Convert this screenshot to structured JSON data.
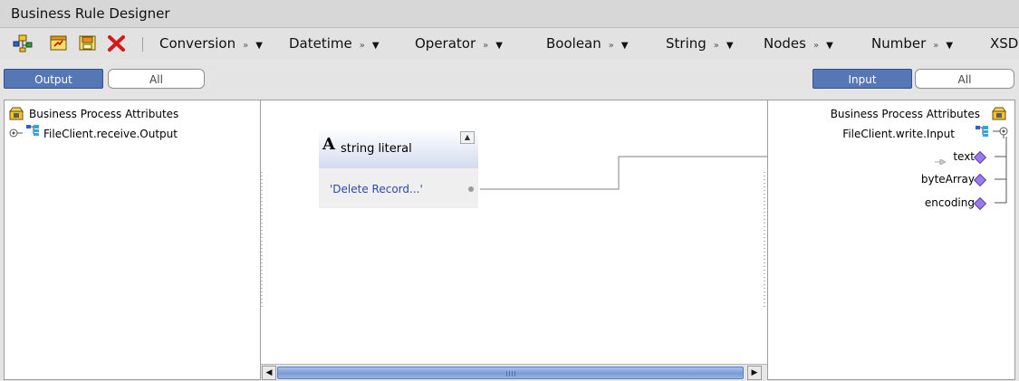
{
  "window": {
    "title": "Business Rule Designer"
  },
  "toolbar": {
    "icons": [
      "tree-add-icon",
      "edit-icon",
      "save-icon",
      "delete-icon"
    ],
    "menus": [
      {
        "label": "Conversion"
      },
      {
        "label": "Datetime"
      },
      {
        "label": "Operator"
      },
      {
        "label": "Boolean"
      },
      {
        "label": "String"
      },
      {
        "label": "Nodes"
      },
      {
        "label": "Number"
      },
      {
        "label": "XSD"
      }
    ],
    "chevron": "»",
    "dropdown": "▼"
  },
  "output_panel": {
    "toggle_active": "Output",
    "toggle_inactive": "All",
    "root_label": "Business Process Attributes",
    "child_label": "FileClient.receive.Output"
  },
  "input_panel": {
    "toggle_active": "Input",
    "toggle_inactive": "All",
    "root_label": "Business Process Attributes",
    "child_label": "FileClient.write.Input",
    "fields": [
      {
        "label": "text"
      },
      {
        "label": "byteArray"
      },
      {
        "label": "encoding"
      }
    ]
  },
  "literal_node": {
    "type_glyph": "A",
    "title": "string literal",
    "value": "'Delete Record...'"
  },
  "colors": {
    "active_toggle": "#5677b5",
    "literal_value": "#2b49a7",
    "field_port": "#9b7be6"
  }
}
